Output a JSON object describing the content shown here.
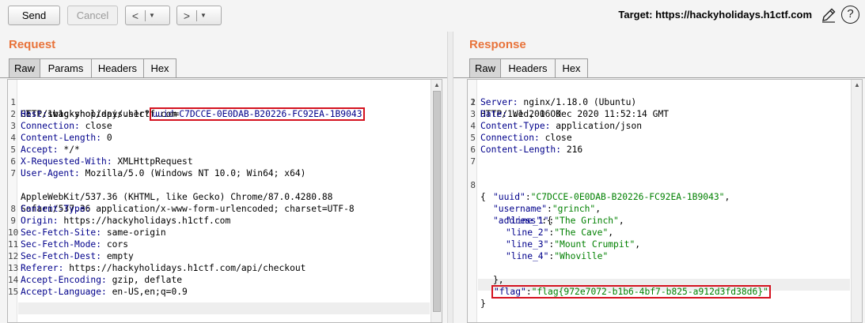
{
  "toolbar": {
    "send_label": "Send",
    "cancel_label": "Cancel",
    "back_glyph": "<",
    "forward_glyph": ">",
    "dropdown_glyph": "▼",
    "target_text": "Target: https://hackyholidays.h1ctf.com",
    "help_glyph": "?"
  },
  "request": {
    "title": "Request",
    "tabs": [
      {
        "label": "Raw",
        "active": true
      },
      {
        "label": "Params",
        "active": false
      },
      {
        "label": "Headers",
        "active": false
      },
      {
        "label": "Hex",
        "active": false
      }
    ],
    "line1_prefix": "GET /swag-shop/api/user?",
    "line1_param_name": "uuid",
    "line1_param_eq": "=",
    "line1_param_value": "C7DCCE-0E0DAB-B20226-FC92EA-1B9043",
    "line1_suffix": "HTTP/1.1",
    "headers": [
      {
        "num": "2",
        "name": "Host:",
        "value": " hackyholidays.h1ctf.com"
      },
      {
        "num": "3",
        "name": "Connection:",
        "value": " close"
      },
      {
        "num": "4",
        "name": "Content-Length:",
        "value": " 0"
      },
      {
        "num": "5",
        "name": "Accept:",
        "value": " */*"
      },
      {
        "num": "6",
        "name": "X-Requested-With:",
        "value": " XMLHttpRequest"
      },
      {
        "num": "7",
        "name": "User-Agent:",
        "value": " Mozilla/5.0 (Windows NT 10.0; Win64; x64)"
      }
    ],
    "ua_cont1": "AppleWebKit/537.36 (KHTML, like Gecko) Chrome/87.0.4280.88",
    "ua_cont2": "Safari/537.36",
    "headers2": [
      {
        "num": "8",
        "name": "Content-Type:",
        "value": " application/x-www-form-urlencoded; charset=UTF-8"
      },
      {
        "num": "9",
        "name": "Origin:",
        "value": " https://hackyholidays.h1ctf.com"
      },
      {
        "num": "10",
        "name": "Sec-Fetch-Site:",
        "value": " same-origin"
      },
      {
        "num": "11",
        "name": "Sec-Fetch-Mode:",
        "value": " cors"
      },
      {
        "num": "12",
        "name": "Sec-Fetch-Dest:",
        "value": " empty"
      },
      {
        "num": "13",
        "name": "Referer:",
        "value": " https://hackyholidays.h1ctf.com/api/checkout"
      },
      {
        "num": "14",
        "name": "Accept-Encoding:",
        "value": " gzip, deflate"
      },
      {
        "num": "15",
        "name": "Accept-Language:",
        "value": " en-US,en;q=0.9"
      }
    ]
  },
  "response": {
    "title": "Response",
    "tabs": [
      {
        "label": "Raw",
        "active": true
      },
      {
        "label": "Headers",
        "active": false
      },
      {
        "label": "Hex",
        "active": false
      }
    ],
    "status_line": "HTTP/1.1 200 OK",
    "headers": [
      {
        "num": "2",
        "name": "Server:",
        "value": " nginx/1.18.0 (Ubuntu)"
      },
      {
        "num": "3",
        "name": "Date:",
        "value": " Wed, 16 Dec 2020 11:52:14 GMT"
      },
      {
        "num": "4",
        "name": "Content-Type:",
        "value": " application/json"
      },
      {
        "num": "5",
        "name": "Connection:",
        "value": " close"
      },
      {
        "num": "6",
        "name": "Content-Length:",
        "value": " 216"
      }
    ],
    "body": {
      "open_brace": "{",
      "close_brace": "}",
      "uuid_key": "\"uuid\"",
      "uuid_value": "\"C7DCCE-0E0DAB-B20226-FC92EA-1B9043\"",
      "username_key": "\"username\"",
      "username_value": "\"grinch\"",
      "address_key": "\"address\"",
      "address_lines": [
        {
          "key": "\"line_1\"",
          "value": "\"The Grinch\"",
          "comma": ","
        },
        {
          "key": "\"line_2\"",
          "value": "\"The Cave\"",
          "comma": ","
        },
        {
          "key": "\"line_3\"",
          "value": "\"Mount Crumpit\"",
          "comma": ","
        },
        {
          "key": "\"line_4\"",
          "value": "\"Whoville\"",
          "comma": ""
        }
      ],
      "address_close": "},",
      "flag_key": "\"flag\"",
      "flag_value": "\"flag{972e7072-b1b6-4bf7-b825-a912d3fd38d6}\""
    }
  },
  "colors": {
    "accent_orange": "#e8733a",
    "highlight_red": "#d4121f",
    "header_name_blue": "#00008b",
    "json_string_green": "#008000"
  },
  "icons": {
    "pencil": "pencil-icon",
    "help": "help-icon",
    "scroll_up": "scroll-up-arrow-icon"
  }
}
